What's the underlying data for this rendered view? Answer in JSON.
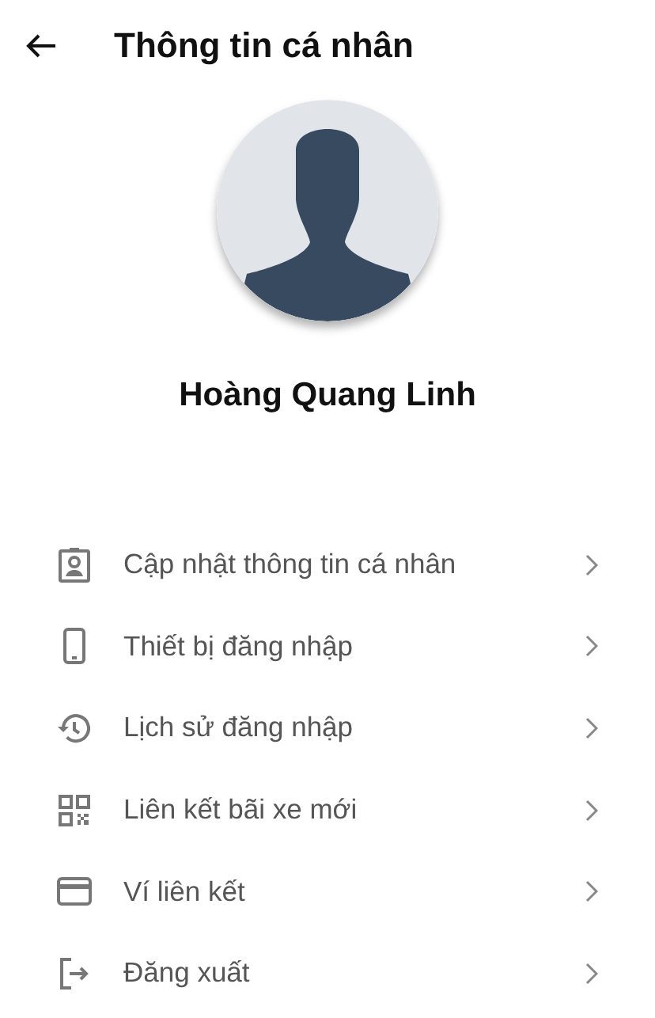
{
  "header": {
    "title": "Thông tin cá nhân"
  },
  "profile": {
    "name": "Hoàng Quang Linh"
  },
  "menu": [
    {
      "kind": "badge",
      "label": "Cập nhật thông tin cá nhân"
    },
    {
      "kind": "phone",
      "label": "Thiết bị đăng nhập"
    },
    {
      "kind": "history",
      "label": "Lịch sử đăng nhập"
    },
    {
      "kind": "qr",
      "label": "Liên kết bãi xe mới"
    },
    {
      "kind": "card",
      "label": "Ví liên kết"
    },
    {
      "kind": "logout",
      "label": "Đăng xuất"
    }
  ]
}
